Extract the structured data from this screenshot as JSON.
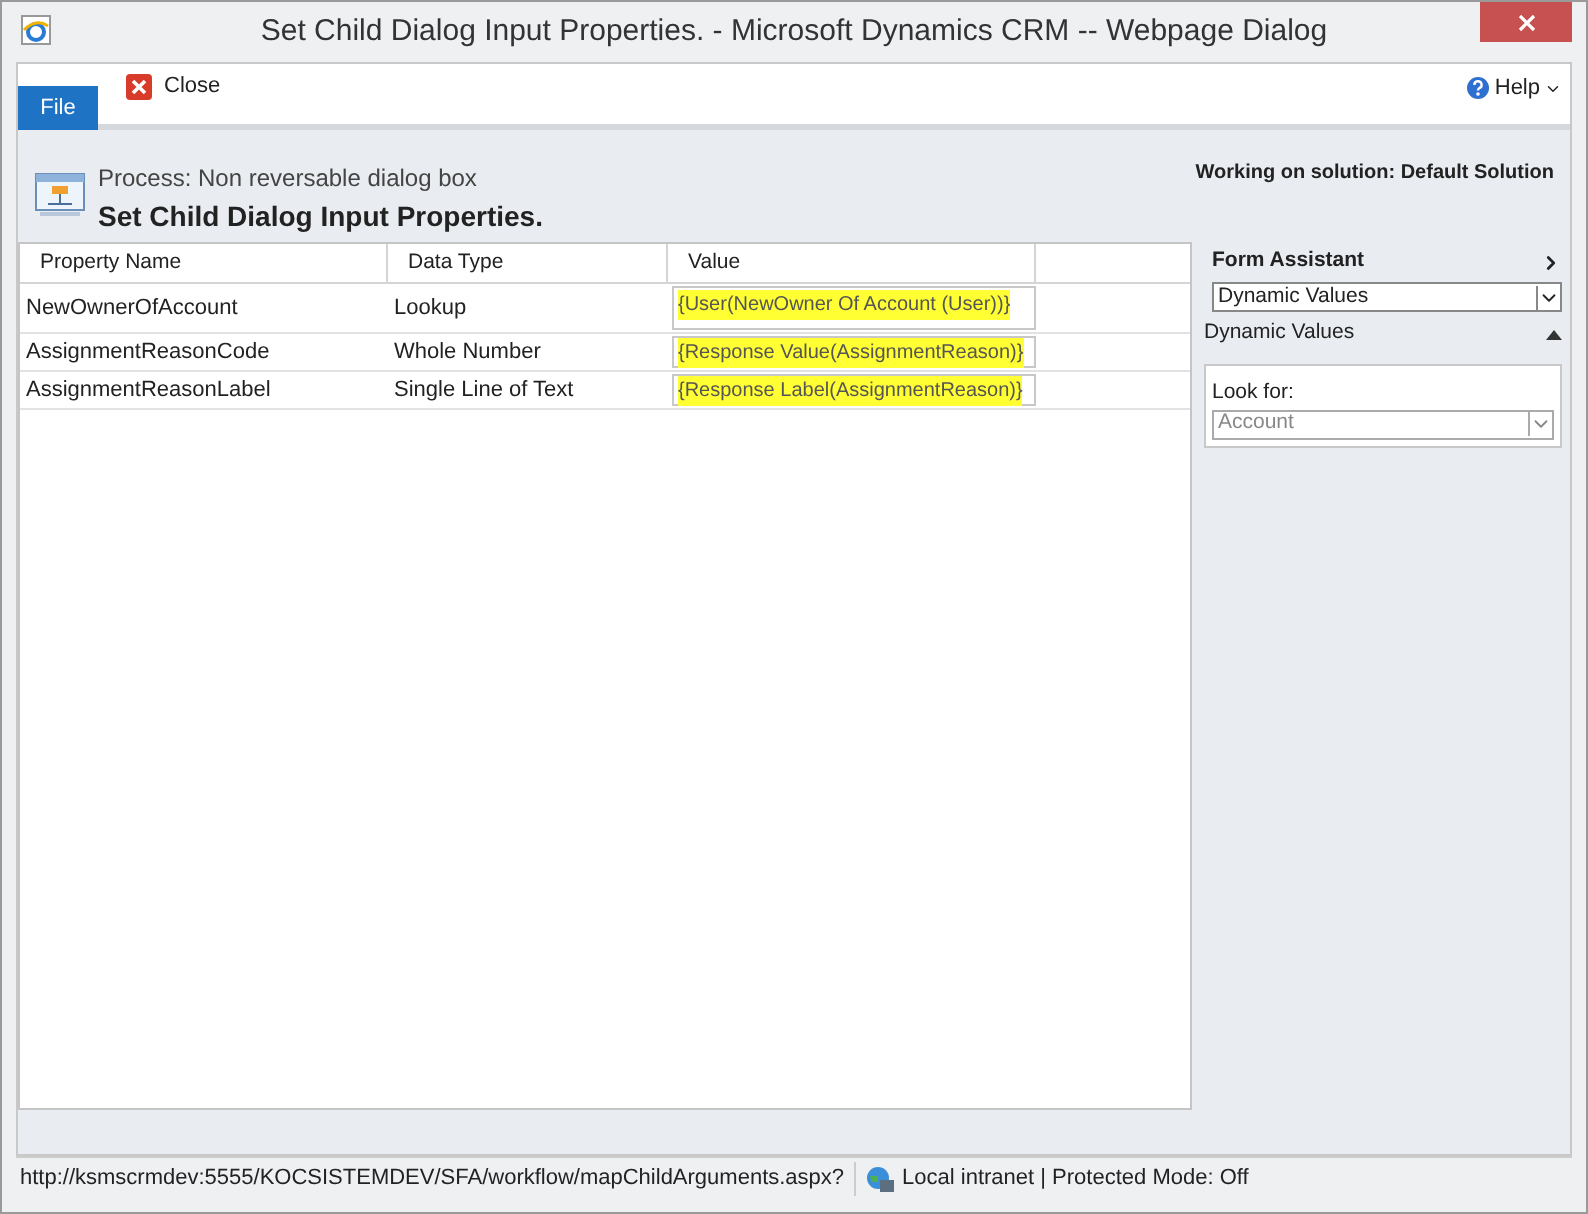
{
  "window": {
    "title": "Set Child Dialog Input Properties. - Microsoft Dynamics CRM -- Webpage Dialog"
  },
  "ribbon": {
    "file_tab": "File",
    "close": "Close",
    "help": "Help"
  },
  "header": {
    "process": "Process: Non reversable dialog box",
    "title": "Set Child Dialog Input Properties.",
    "solution": "Working on solution: Default Solution"
  },
  "table": {
    "columns": [
      "Property Name",
      "Data Type",
      "Value"
    ],
    "rows": [
      {
        "name": "NewOwnerOfAccount",
        "type": "Lookup",
        "value": "{User(NewOwner Of Account (User))}"
      },
      {
        "name": "AssignmentReasonCode",
        "type": "Whole Number",
        "value": "{Response Value(AssignmentReason)}"
      },
      {
        "name": "AssignmentReasonLabel",
        "type": "Single Line of Text",
        "value": "{Response Label(AssignmentReason)}"
      }
    ]
  },
  "form_assistant": {
    "title": "Form Assistant",
    "dropdown": "Dynamic Values",
    "section": "Dynamic Values",
    "look_for_label": "Look for:",
    "look_for_value": "Account"
  },
  "status_bar": {
    "url": "http://ksmscrmdev:5555/KOCSISTEMDEV/SFA/workflow/mapChildArguments.aspx?",
    "zone": "Local intranet | Protected Mode: Off"
  }
}
